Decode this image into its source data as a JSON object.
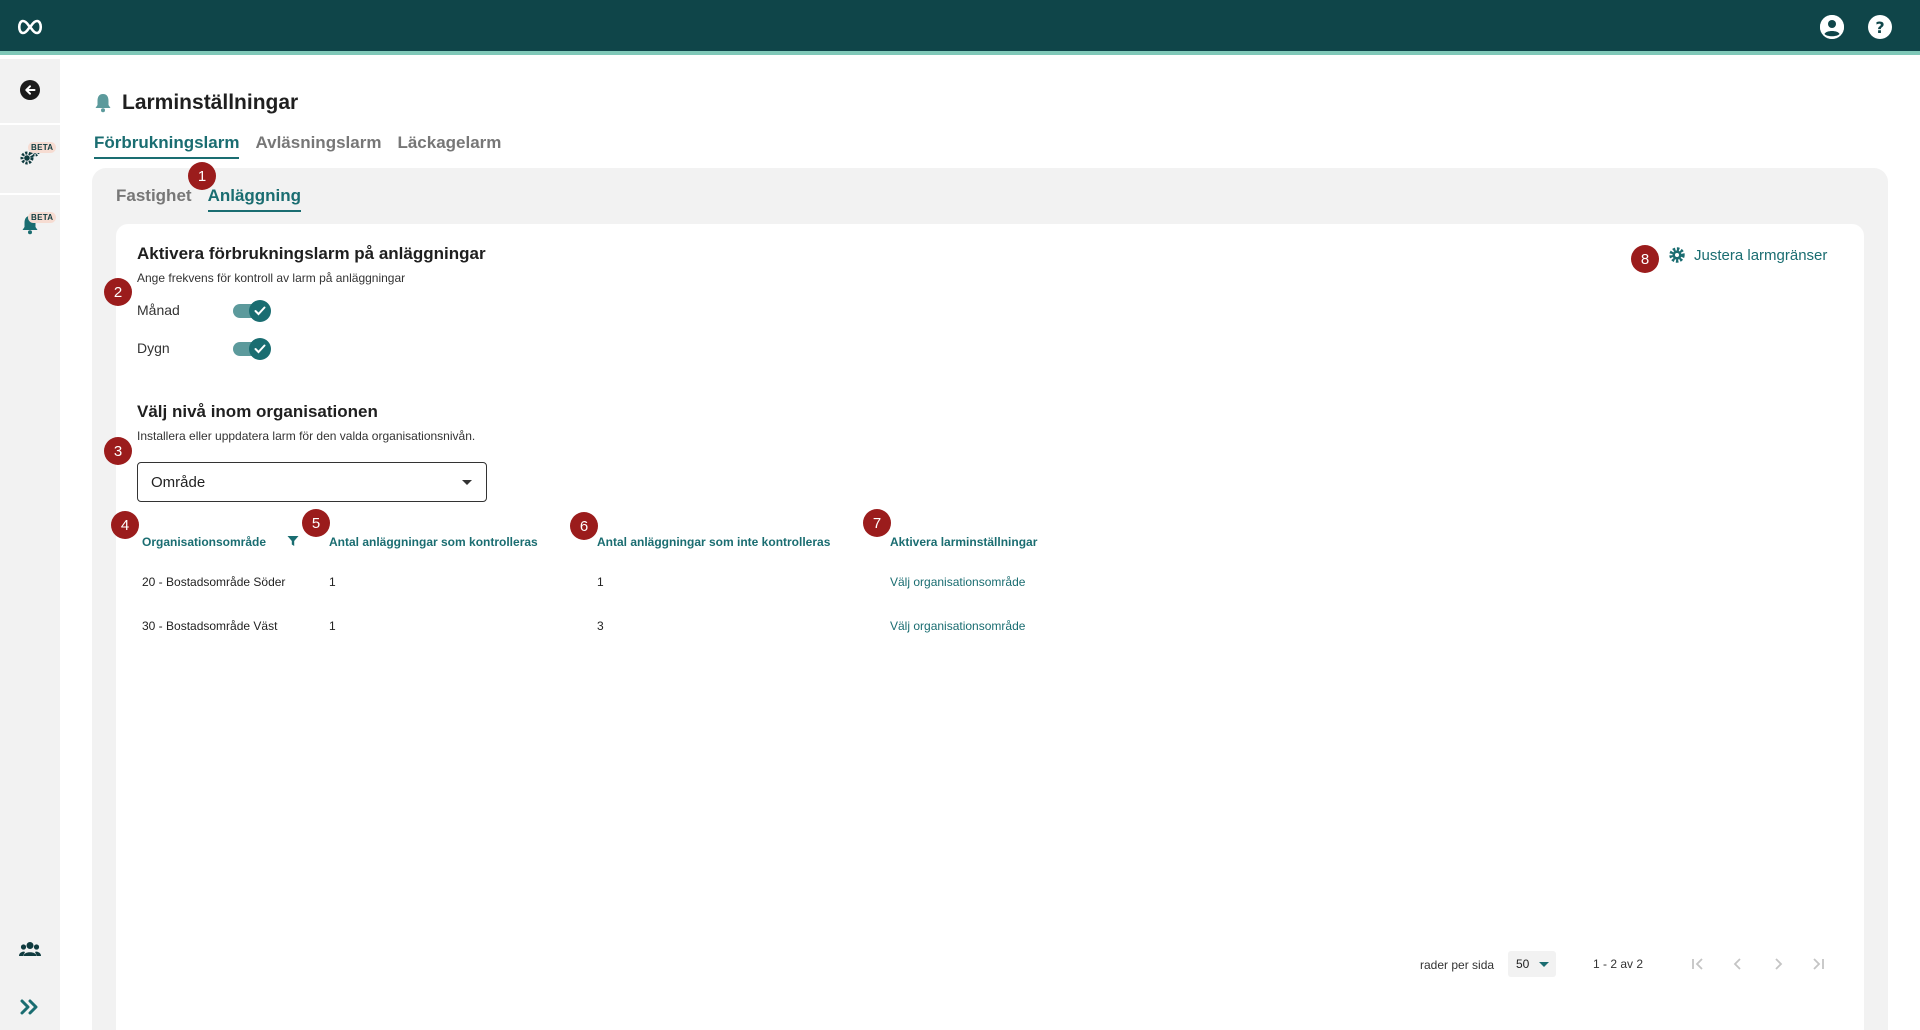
{
  "header": {
    "logo": "infinity-logo",
    "icons": [
      "account-circle-icon",
      "help-icon"
    ]
  },
  "sidebar": {
    "beta_badge": "BETA",
    "icons": [
      "back-arrow-icon",
      "gears-icon",
      "bell-icon",
      "users-icon",
      "double-chevron-right-icon"
    ]
  },
  "page": {
    "title": "Larminställningar"
  },
  "tabs": {
    "main": [
      "Förbrukningslarm",
      "Avläsningslarm",
      "Läckagelarm"
    ],
    "main_active": "Förbrukningslarm",
    "sub": [
      "Fastighet",
      "Anläggning"
    ],
    "sub_active": "Anläggning"
  },
  "section1": {
    "title": "Aktivera förbrukningslarm på anläggningar",
    "subtitle": "Ange frekvens för kontroll av larm på anläggningar",
    "toggles": [
      {
        "label": "Månad",
        "checked": true
      },
      {
        "label": "Dygn",
        "checked": true
      }
    ]
  },
  "section2": {
    "title": "Välj nivå inom organisationen",
    "subtitle": "Installera eller uppdatera larm för den valda organisationsnivån.",
    "select_value": "Område"
  },
  "justera": {
    "label": "Justera larmgränser"
  },
  "table": {
    "headers": [
      "Organisationsområde",
      "Antal anläggningar som kontrolleras",
      "Antal anläggningar som inte kontrolleras",
      "Aktivera larminställningar"
    ],
    "rows": [
      [
        "20 - Bostadsområde Söder",
        "1",
        "1",
        "Välj organisationsområde"
      ],
      [
        "30 - Bostadsområde Väst",
        "1",
        "3",
        "Välj organisationsområde"
      ]
    ]
  },
  "pagination": {
    "rows_per_page_label": "rader per sida",
    "rows_per_page": "50",
    "range": "1 - 2 av 2"
  },
  "markers": [
    "1",
    "2",
    "3",
    "4",
    "5",
    "6",
    "7",
    "8"
  ],
  "colors": {
    "topbar": "#0f4549",
    "accent": "#1a6d71",
    "marker": "#9b1c1c",
    "panel": "#f2f2f2"
  }
}
